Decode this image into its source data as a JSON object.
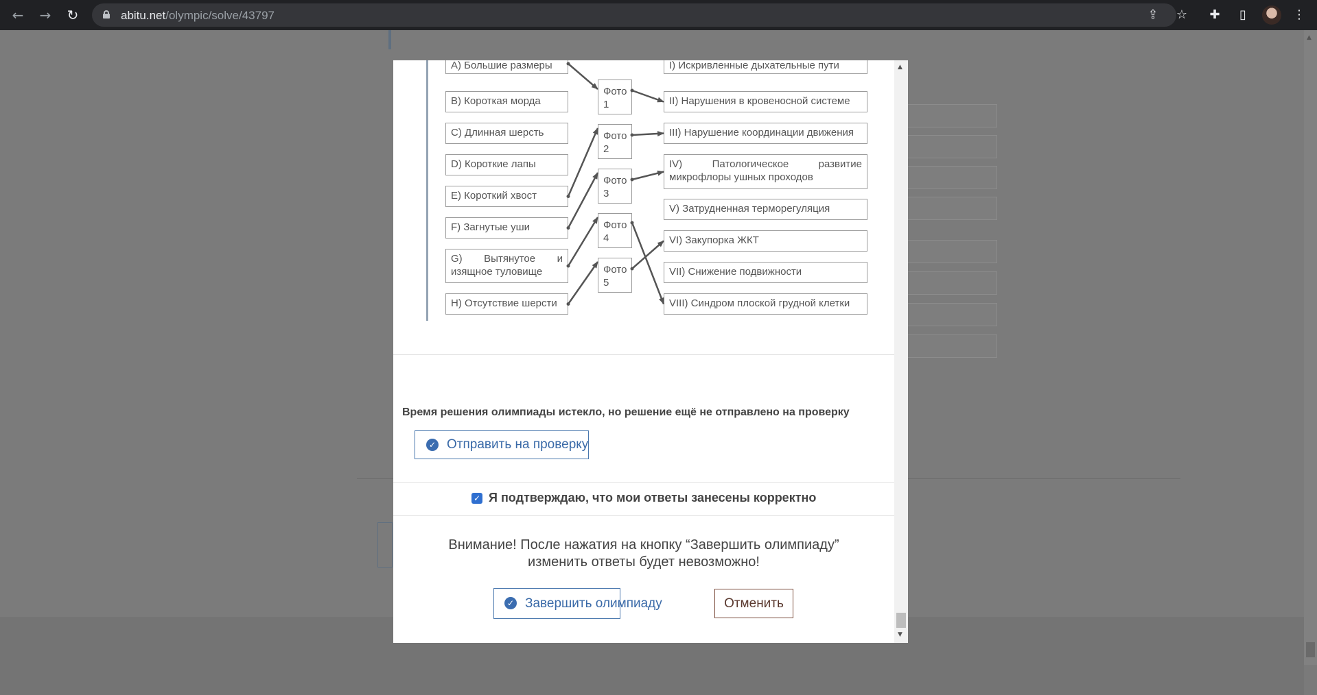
{
  "browser": {
    "url_domain": "abitu.net",
    "url_path": "/olympic/solve/43797",
    "icons": [
      "back-icon",
      "forward-icon",
      "reload-icon",
      "lock-icon",
      "share-icon",
      "star-icon",
      "extensions-icon",
      "sidepanel-icon",
      "menu-icon"
    ]
  },
  "matching": {
    "features": [
      "A) Большие размеры",
      "B) Короткая морда",
      "C) Длинная шерсть",
      "D) Короткие лапы",
      "E) Короткий хвост",
      "F) Загнутые уши",
      "G) Вытянутое и изящное туловище",
      "H) Отсутствие шерсти"
    ],
    "photos": [
      "Фото 1",
      "Фото 2",
      "Фото 3",
      "Фото 4",
      "Фото 5"
    ],
    "problems": [
      "I) Искривленные дыхательные пути",
      "II) Нарушения в кровеносной системе",
      "III) Нарушение координации движения",
      "IV) Патологическое развитие микрофлоры ушных проходов",
      "V) Затрудненная терморегуляция",
      "VI) Закупорка ЖКТ",
      "VII) Снижение подвижности",
      "VIII) Синдром плоской грудной клетки"
    ],
    "feature_to_photo": [
      {
        "feature": "A",
        "photo": 1
      },
      {
        "feature": "E",
        "photo": 2
      },
      {
        "feature": "F",
        "photo": 3
      },
      {
        "feature": "G",
        "photo": 4
      },
      {
        "feature": "H",
        "photo": 5
      }
    ],
    "photo_to_problem": [
      {
        "photo": 1,
        "problem": "II"
      },
      {
        "photo": 2,
        "problem": "III"
      },
      {
        "photo": 3,
        "problem": "IV"
      },
      {
        "photo": 4,
        "problem": "VIII"
      },
      {
        "photo": 5,
        "problem": "VI"
      }
    ]
  },
  "modal": {
    "expired_text": "Время решения олимпиады истекло, но решение ещё не отправлено на проверку",
    "submit_label": "Отправить на проверку",
    "confirm_checked": true,
    "confirm_text": "Я подтверждаю, что мои ответы занесены корректно",
    "warning_line1": "Внимание! После нажатия на кнопку “Завершить олимпиаду”",
    "warning_line2": "изменить ответы будет невозможно!",
    "finish_label": "Завершить олимпиаду",
    "cancel_label": "Отменить"
  },
  "colors": {
    "accent": "#3b6db0",
    "cancel_border": "#7a4a3a",
    "overlay": "#7b7b7b"
  }
}
